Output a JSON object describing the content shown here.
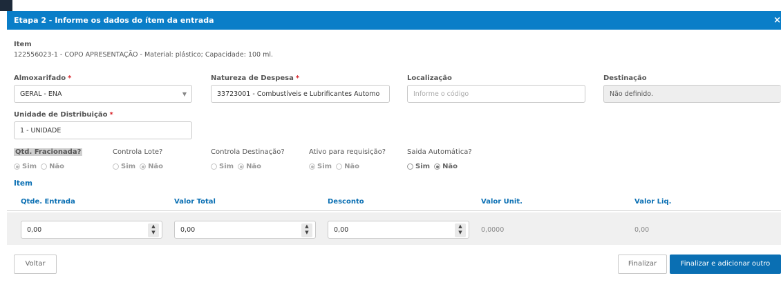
{
  "dialog": {
    "title": "Etapa 2 - Informe os dados do ítem da entrada",
    "close": "×"
  },
  "item": {
    "label": "Item",
    "description": "122556023-1 - COPO APRESENTAÇÃO - Material: plástico; Capacidade: 100 ml."
  },
  "fields": {
    "almoxarifado": {
      "label": "Almoxarifado",
      "value": "GERAL - ENA"
    },
    "natureza": {
      "label": "Natureza de Despesa",
      "value": "33723001 - Combustíveis e Lubrificantes Automo"
    },
    "localizacao": {
      "label": "Localização",
      "placeholder": "Informe o código"
    },
    "destinacao": {
      "label": "Destinação",
      "value": "Não definido."
    },
    "unidade": {
      "label": "Unidade de Distribuição",
      "value": "1 - UNIDADE"
    },
    "required_mark": "*"
  },
  "options": {
    "sim": "Sim",
    "nao": "Não",
    "qtd_fracionada": "Qtd. Fracionada?",
    "controla_lote": "Controla Lote?",
    "controla_destinacao": "Controla Destinação?",
    "ativo_requisicao": "Ativo para requisição?",
    "saida_automatica": "Saida Automática?"
  },
  "item_table": {
    "section_title": "Item",
    "headers": [
      "Qtde. Entrada",
      "Valor Total",
      "Desconto",
      "Valor Unit.",
      "Valor Liq."
    ],
    "qtde_entrada": "0,00",
    "valor_total": "0,00",
    "desconto": "0,00",
    "valor_unit": "0,0000",
    "valor_liq": "0,00"
  },
  "buttons": {
    "voltar": "Voltar",
    "finalizar": "Finalizar",
    "finalizar_adicionar": "Finalizar e adicionar outro"
  },
  "icons": {
    "spinner": "up-down-arrows",
    "dropdown": "caret-down"
  }
}
